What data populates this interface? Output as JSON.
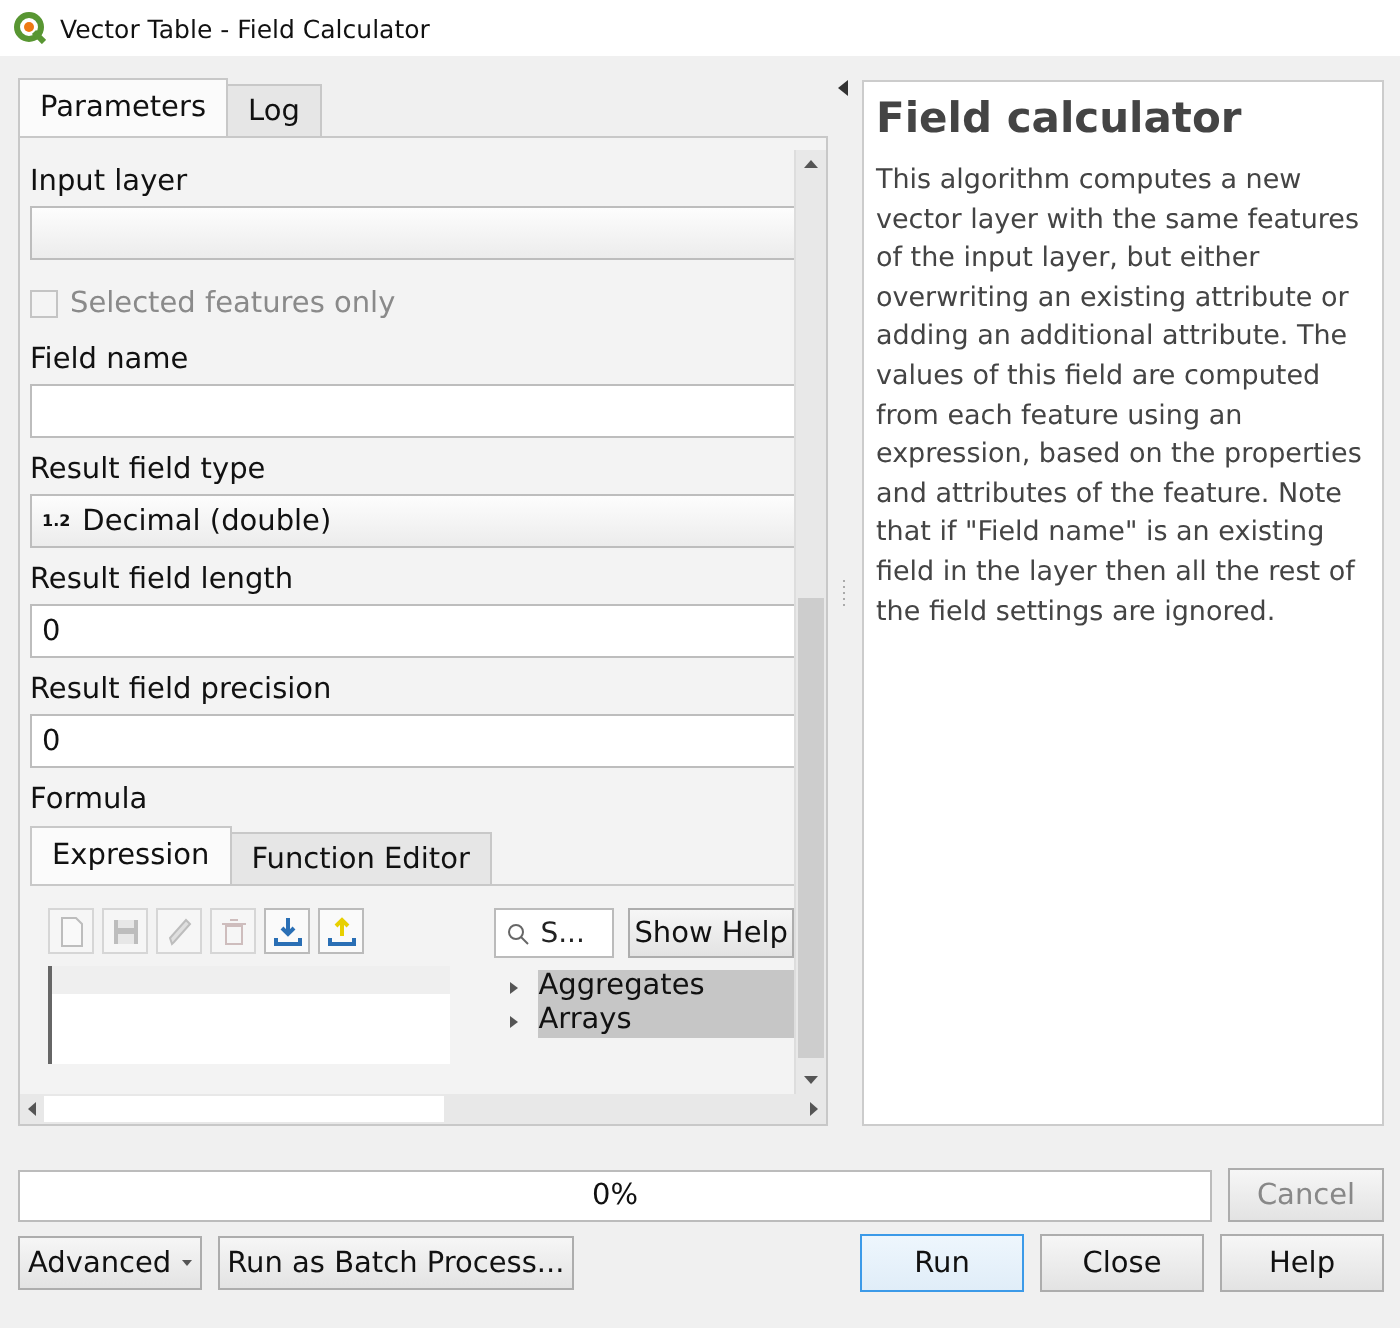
{
  "window": {
    "title": "Vector Table - Field Calculator"
  },
  "tabs": [
    {
      "label": "Parameters",
      "selected": true
    },
    {
      "label": "Log",
      "selected": false
    }
  ],
  "parameters": [
    {
      "kind": "combo",
      "label": "Input layer"
    },
    {
      "kind": "checkbox",
      "label": "Selected features only",
      "checked": false,
      "disabled": true
    },
    {
      "kind": "text",
      "label": "Field name"
    },
    {
      "kind": "combo",
      "label": "Result field type",
      "badge": "1.2",
      "value": "Decimal (double)"
    },
    {
      "kind": "text",
      "label": "Result field length",
      "value": "0"
    },
    {
      "kind": "text",
      "label": "Result field precision",
      "value": "0"
    }
  ],
  "formula": {
    "label": "Formula",
    "tabs": [
      {
        "label": "Expression",
        "selected": true
      },
      {
        "label": "Function Editor",
        "selected": false
      }
    ],
    "toolbar": [
      {
        "kind": "new",
        "disabled": true
      },
      {
        "kind": "save",
        "disabled": true
      },
      {
        "kind": "edit",
        "disabled": true
      },
      {
        "kind": "delete",
        "disabled": true
      },
      {
        "kind": "import",
        "disabled": false
      },
      {
        "kind": "export",
        "disabled": false
      }
    ],
    "search": {
      "placeholder": "S..."
    },
    "show_help": "Show Help",
    "functions": [
      {
        "label": "Aggregates",
        "expanded": false
      },
      {
        "label": "Arrays",
        "expanded": false
      }
    ]
  },
  "help": {
    "title": "Field calculator",
    "body": "This algorithm computes a new vector layer with the same features of the input layer, but either overwriting an existing attribute or adding an additional attribute. The values of this field are computed from each feature using an expression, based on the properties and attributes of the feature. Note that if \"Field name\" is an existing field in the layer then all the rest of the field settings are ignored."
  },
  "progress": {
    "level": 0,
    "text": "0%"
  },
  "cancel": {
    "label": "Cancel",
    "disabled": true
  },
  "buttons_left": [
    {
      "kind": "menu",
      "label": "Advanced"
    },
    {
      "kind": "plain",
      "label": "Run as Batch Process..."
    }
  ],
  "buttons_right": [
    {
      "kind": "default",
      "label": "Run"
    },
    {
      "kind": "plain",
      "label": "Close"
    },
    {
      "kind": "plain",
      "label": "Help"
    }
  ]
}
